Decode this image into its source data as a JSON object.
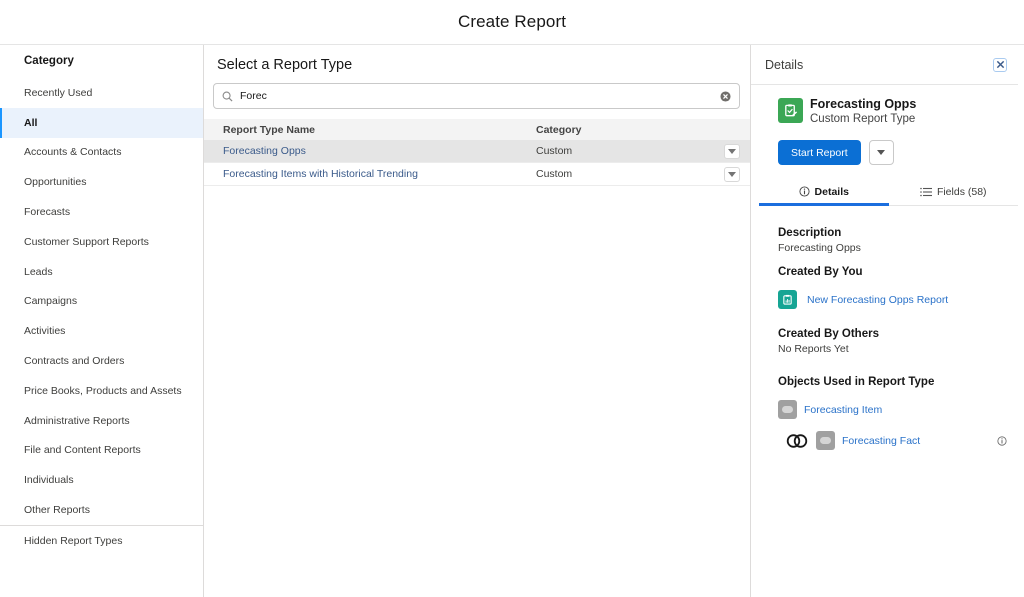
{
  "header": {
    "title": "Create Report"
  },
  "sidebar": {
    "heading": "Category",
    "items": [
      {
        "label": "Recently Used",
        "active": false
      },
      {
        "label": "All",
        "active": true
      },
      {
        "label": "Accounts & Contacts",
        "active": false
      },
      {
        "label": "Opportunities",
        "active": false
      },
      {
        "label": "Forecasts",
        "active": false
      },
      {
        "label": "Customer Support Reports",
        "active": false
      },
      {
        "label": "Leads",
        "active": false
      },
      {
        "label": "Campaigns",
        "active": false
      },
      {
        "label": "Activities",
        "active": false
      },
      {
        "label": "Contracts and Orders",
        "active": false
      },
      {
        "label": "Price Books, Products and Assets",
        "active": false
      },
      {
        "label": "Administrative Reports",
        "active": false
      },
      {
        "label": "File and Content Reports",
        "active": false
      },
      {
        "label": "Individuals",
        "active": false
      },
      {
        "label": "Other Reports",
        "active": false
      }
    ],
    "hidden_label": "Hidden Report Types"
  },
  "main": {
    "title": "Select a Report Type",
    "search": {
      "value": "Forec",
      "placeholder": "Search Report Types...",
      "icon": "search-icon",
      "clear_icon": "clear-icon"
    },
    "table": {
      "columns": [
        "Report Type Name",
        "Category"
      ],
      "rows": [
        {
          "name": "Forecasting Opps",
          "category": "Custom",
          "selected": true
        },
        {
          "name": "Forecasting Items with Historical Trending",
          "category": "Custom",
          "selected": false
        }
      ]
    }
  },
  "details": {
    "title": "Details",
    "close_icon": "close-icon",
    "report_type": {
      "name": "Forecasting Opps",
      "subtitle": "Custom Report Type",
      "icon_color": "#3ba755"
    },
    "start_button": "Start Report",
    "tabs": [
      {
        "label": "Details",
        "icon": "info-icon",
        "active": true
      },
      {
        "label": "Fields (58)",
        "icon": "list-icon",
        "active": false
      }
    ],
    "description_label": "Description",
    "description": "Forecasting Opps",
    "created_by_you_label": "Created By You",
    "created_by_you_link": "New Forecasting Opps Report",
    "created_by_others_label": "Created By Others",
    "created_by_others_text": "No Reports Yet",
    "objects_label": "Objects Used in Report Type",
    "objects": [
      {
        "name": "Forecasting Item"
      },
      {
        "name": "Forecasting Fact"
      }
    ]
  },
  "colors": {
    "accent": "#0b6fd4",
    "link": "#2a72c9",
    "active_bg": "#eaf2fc",
    "selected_row": "#e5e5e5"
  }
}
